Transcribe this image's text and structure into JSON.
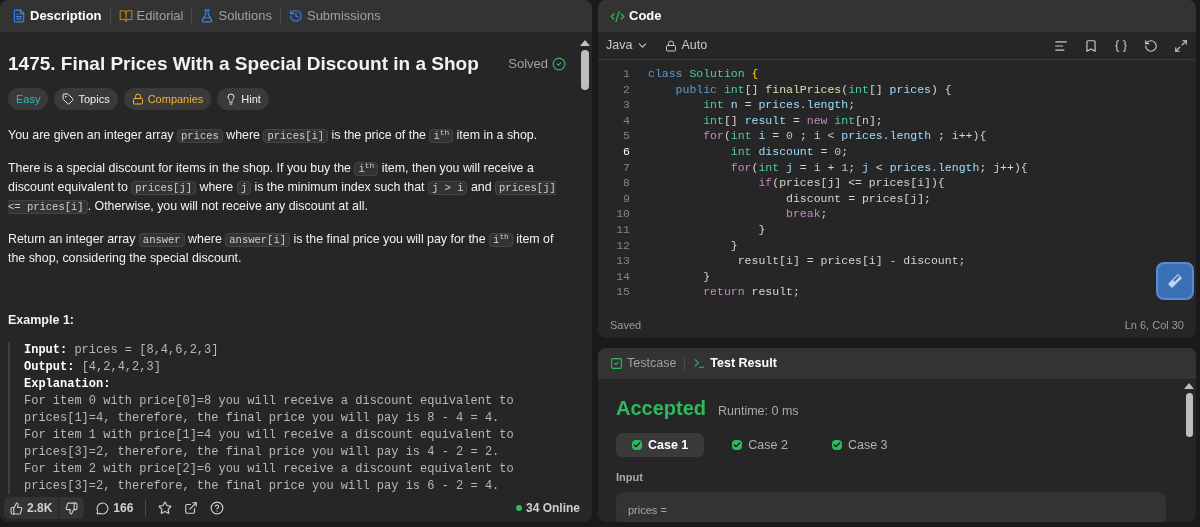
{
  "left_tabs": [
    {
      "label": "Description",
      "kind": "description",
      "selected": true
    },
    {
      "label": "Editorial",
      "kind": "editorial",
      "selected": false
    },
    {
      "label": "Solutions",
      "kind": "solutions",
      "selected": false
    },
    {
      "label": "Submissions",
      "kind": "submissions",
      "selected": false
    }
  ],
  "problem": {
    "title": "1475. Final Prices With a Special Discount in a Shop",
    "status": "Solved",
    "tags": [
      {
        "label": "Easy",
        "kind": "difficulty"
      },
      {
        "label": "Topics",
        "kind": "topics"
      },
      {
        "label": "Companies",
        "kind": "companies"
      },
      {
        "label": "Hint",
        "kind": "hint"
      }
    ],
    "paragraphs": [
      [
        {
          "kind": "text",
          "text": "You are given an integer array "
        },
        {
          "kind": "code",
          "text": "prices"
        },
        {
          "kind": "text",
          "text": " where "
        },
        {
          "kind": "code",
          "text": "prices[i]"
        },
        {
          "kind": "text",
          "text": " is the price of the "
        },
        {
          "kind": "code",
          "text": "i$^{th}$"
        },
        {
          "kind": "text",
          "text": " item in a shop."
        }
      ],
      [
        {
          "kind": "text",
          "text": "There is a special discount for items in the shop. If you buy the "
        },
        {
          "kind": "code",
          "text": "i$^{th}$"
        },
        {
          "kind": "text",
          "text": " item, then you will receive a discount equivalent to "
        },
        {
          "kind": "code",
          "text": "prices[j]"
        },
        {
          "kind": "text",
          "text": " where "
        },
        {
          "kind": "code",
          "text": "j"
        },
        {
          "kind": "text",
          "text": " is the minimum index such that "
        },
        {
          "kind": "code",
          "text": "j > i"
        },
        {
          "kind": "text",
          "text": " and "
        },
        {
          "kind": "code",
          "text": "prices[j] <= prices[i]"
        },
        {
          "kind": "text",
          "text": ". Otherwise, you will not receive any discount at all."
        }
      ],
      [
        {
          "kind": "text",
          "text": "Return an integer array "
        },
        {
          "kind": "code",
          "text": "answer"
        },
        {
          "kind": "text",
          "text": " where "
        },
        {
          "kind": "code",
          "text": "answer[i]"
        },
        {
          "kind": "text",
          "text": " is the final price you will pay for the "
        },
        {
          "kind": "code",
          "text": "i$^{th}$"
        },
        {
          "kind": "text",
          "text": " item of the shop, considering the special discount."
        }
      ]
    ],
    "example": {
      "title": "Example 1:",
      "input_label": "Input:",
      "input": "prices = [8,4,6,2,3]",
      "output_label": "Output:",
      "output": "[4,2,4,2,3]",
      "explanation_label": "Explanation:",
      "explanation_lines": [
        "For item 0 with price[0]=8 you will receive a discount equivalent to",
        "prices[1]=4, therefore, the final price you will pay is 8 - 4 = 4.",
        "For item 1 with price[1]=4 you will receive a discount equivalent to",
        "prices[3]=2, therefore, the final price you will pay is 4 - 2 = 2.",
        "For item 2 with price[2]=6 you will receive a discount equivalent to",
        "prices[3]=2, therefore, the final price you will pay is 6 - 2 = 4."
      ]
    }
  },
  "footer": {
    "likes": "2.8K",
    "comments": "166",
    "online": "34 Online"
  },
  "code_panel": {
    "title": "Code",
    "language": "Java",
    "mode": "Auto",
    "status": "Saved",
    "cursor": "Ln 6, Col 30",
    "lines": [
      {
        "number": "1",
        "current": false,
        "tokens": [
          {
            "kind": "kw",
            "text": "class"
          },
          {
            "kind": "type",
            "text": " Solution"
          },
          {
            "kind": "brace",
            "text": " {"
          }
        ]
      },
      {
        "number": "2",
        "current": false,
        "tokens": [
          {
            "kind": "kw",
            "text": "    public"
          },
          {
            "kind": "type",
            "text": " int"
          },
          {
            "kind": "p",
            "text": "[]"
          },
          {
            "kind": "fn",
            "text": " finalPrices"
          },
          {
            "kind": "p",
            "text": "("
          },
          {
            "kind": "type",
            "text": "int"
          },
          {
            "kind": "p",
            "text": "[]"
          },
          {
            "kind": "var",
            "text": " prices"
          },
          {
            "kind": "p",
            "text": ") {"
          }
        ]
      },
      {
        "number": "3",
        "current": false,
        "tokens": [
          {
            "kind": "type",
            "text": "        int"
          },
          {
            "kind": "var",
            "text": " n"
          },
          {
            "kind": "p",
            "text": " ="
          },
          {
            "kind": "var",
            "text": " prices.length"
          },
          {
            "kind": "p",
            "text": ";"
          }
        ]
      },
      {
        "number": "4",
        "current": false,
        "tokens": [
          {
            "kind": "type",
            "text": "        int"
          },
          {
            "kind": "p",
            "text": "[]"
          },
          {
            "kind": "var",
            "text": " result"
          },
          {
            "kind": "p",
            "text": " ="
          },
          {
            "kind": "ctrl",
            "text": " new"
          },
          {
            "kind": "type",
            "text": " int"
          },
          {
            "kind": "p",
            "text": "["
          },
          {
            "kind": "var",
            "text": "n"
          },
          {
            "kind": "p",
            "text": "];"
          }
        ]
      },
      {
        "number": "5",
        "current": false,
        "tokens": [
          {
            "kind": "ctrl",
            "text": "        for"
          },
          {
            "kind": "p",
            "text": "("
          },
          {
            "kind": "type",
            "text": "int"
          },
          {
            "kind": "var",
            "text": " i"
          },
          {
            "kind": "p",
            "text": " ="
          },
          {
            "kind": "num",
            "text": " 0"
          },
          {
            "kind": "p",
            "text": " ;"
          },
          {
            "kind": "var",
            "text": " i"
          },
          {
            "kind": "p",
            "text": " <"
          },
          {
            "kind": "var",
            "text": " prices.length"
          },
          {
            "kind": "p",
            "text": " ;"
          },
          {
            "kind": "var",
            "text": " i"
          },
          {
            "kind": "p",
            "text": "++){"
          }
        ]
      },
      {
        "number": "6",
        "current": true,
        "tokens": [
          {
            "kind": "type",
            "text": "            int"
          },
          {
            "kind": "var",
            "text": " discount"
          },
          {
            "kind": "p",
            "text": " ="
          },
          {
            "kind": "num",
            "text": " 0"
          },
          {
            "kind": "p",
            "text": ";"
          }
        ]
      },
      {
        "number": "7",
        "current": false,
        "tokens": [
          {
            "kind": "ctrl",
            "text": "            for"
          },
          {
            "kind": "p",
            "text": "("
          },
          {
            "kind": "type",
            "text": "int"
          },
          {
            "kind": "var",
            "text": " j"
          },
          {
            "kind": "p",
            "text": " ="
          },
          {
            "kind": "var",
            "text": " i"
          },
          {
            "kind": "p",
            "text": " +"
          },
          {
            "kind": "num",
            "text": " 1"
          },
          {
            "kind": "p",
            "text": ";"
          },
          {
            "kind": "var",
            "text": " j"
          },
          {
            "kind": "p",
            "text": " <"
          },
          {
            "kind": "var",
            "text": " prices.length"
          },
          {
            "kind": "p",
            "text": ";"
          },
          {
            "kind": "var",
            "text": " j"
          },
          {
            "kind": "p",
            "text": "++){"
          }
        ]
      },
      {
        "number": "8",
        "current": false,
        "tokens": [
          {
            "kind": "ctrl",
            "text": "                if"
          },
          {
            "kind": "p",
            "text": "(prices[j] <= prices[i]){"
          }
        ]
      },
      {
        "number": "9",
        "current": false,
        "tokens": [
          {
            "kind": "p",
            "text": "                    discount = prices[j];"
          }
        ]
      },
      {
        "number": "10",
        "current": false,
        "tokens": [
          {
            "kind": "ctrl",
            "text": "                    break"
          },
          {
            "kind": "p",
            "text": ";"
          }
        ]
      },
      {
        "number": "11",
        "current": false,
        "tokens": [
          {
            "kind": "p",
            "text": "                }"
          }
        ]
      },
      {
        "number": "12",
        "current": false,
        "tokens": [
          {
            "kind": "p",
            "text": "            }"
          }
        ]
      },
      {
        "number": "13",
        "current": false,
        "tokens": [
          {
            "kind": "p",
            "text": "             result[i] = prices[i] - discount;"
          }
        ]
      },
      {
        "number": "14",
        "current": false,
        "tokens": [
          {
            "kind": "p",
            "text": "        }"
          }
        ]
      },
      {
        "number": "15",
        "current": false,
        "tokens": [
          {
            "kind": "ctrl",
            "text": "        return"
          },
          {
            "kind": "p",
            "text": " result;"
          }
        ]
      }
    ]
  },
  "test_panel": {
    "tabs": [
      {
        "label": "Testcase",
        "kind": "testcase",
        "selected": false
      },
      {
        "label": "Test Result",
        "kind": "result",
        "selected": true
      }
    ],
    "verdict": "Accepted",
    "runtime": "Runtime: 0 ms",
    "cases": [
      {
        "label": "Case 1",
        "selected": true,
        "passed": true
      },
      {
        "label": "Case 2",
        "selected": false,
        "passed": true
      },
      {
        "label": "Case 3",
        "selected": false,
        "passed": true
      }
    ],
    "input_label": "Input",
    "input_value": "prices ="
  }
}
